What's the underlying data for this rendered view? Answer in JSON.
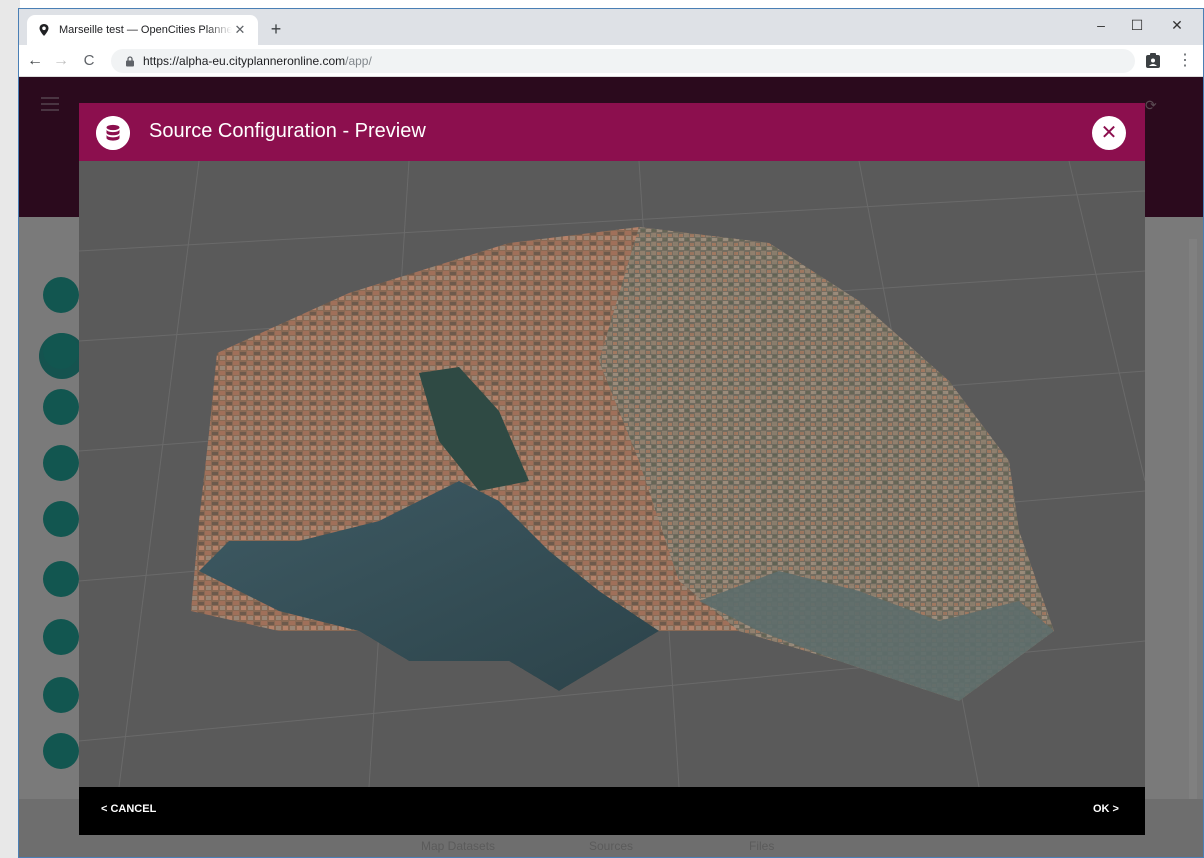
{
  "browser": {
    "tab_title": "Marseille test — OpenCities Planner",
    "tab_close": "✕",
    "new_tab": "+",
    "url_host": "https://alpha-eu.cityplanneronline.com",
    "url_path": "/app/",
    "window_minimize": "–",
    "window_maximize": "☐",
    "window_close": "✕"
  },
  "modal": {
    "title": "Source Configuration - Preview",
    "close_label": "✕",
    "cancel_label": "< CANCEL",
    "ok_label": "OK >"
  },
  "app": {
    "footer_tabs": [
      "Map Datasets",
      "Sources",
      "Files"
    ],
    "accent_color": "#8c0f4e"
  },
  "icons": [
    "map-pin-favicon",
    "lock-icon",
    "profile-icon",
    "kebab-menu-icon",
    "database-icon",
    "hamburger-icon"
  ]
}
